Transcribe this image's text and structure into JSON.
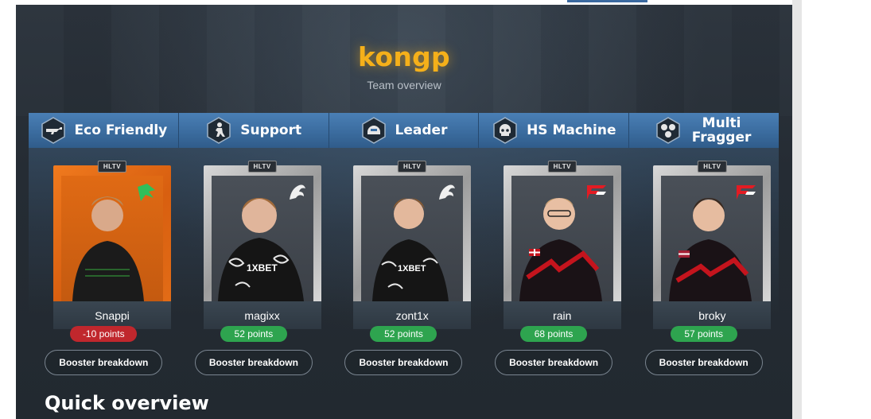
{
  "header": {
    "title": "kongp",
    "subtitle": "Team overview"
  },
  "colors": {
    "title": "#f5b01a",
    "role_bar": "#3b6c9f",
    "points_negative": "#c0272d",
    "points_positive": "#2ea44f",
    "card_orange": "#e56f18",
    "card_silver": "#b0b0b0"
  },
  "roles": [
    {
      "label": "Eco Friendly",
      "icon": "rifle-icon"
    },
    {
      "label": "Support",
      "icon": "soldier-icon"
    },
    {
      "label": "Leader",
      "icon": "helmet-icon"
    },
    {
      "label": "HS Machine",
      "icon": "skull-icon"
    },
    {
      "label": "Multi Fragger",
      "icon": "multi-skull-icon"
    }
  ],
  "players": [
    {
      "name": "Snappi",
      "points": "-10 points",
      "team_logo": "team-falcons-logo",
      "card": "orange",
      "booster": "Booster breakdown"
    },
    {
      "name": "magixx",
      "points": "52 points",
      "team_logo": "team-spirit-logo",
      "card": "silver",
      "booster": "Booster breakdown"
    },
    {
      "name": "zont1x",
      "points": "52 points",
      "team_logo": "team-spirit-logo",
      "card": "silver",
      "booster": "Booster breakdown"
    },
    {
      "name": "rain",
      "points": "68 points",
      "team_logo": "faze-logo",
      "card": "silver",
      "booster": "Booster breakdown"
    },
    {
      "name": "broky",
      "points": "57 points",
      "team_logo": "faze-logo",
      "card": "silver",
      "booster": "Booster breakdown"
    }
  ],
  "card_tag": "HLTV",
  "section": {
    "quick_overview": "Quick overview"
  }
}
